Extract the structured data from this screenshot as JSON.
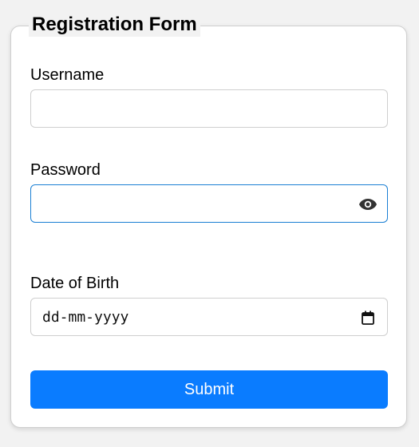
{
  "form": {
    "legend": "Registration Form",
    "fields": [
      {
        "label": "Username",
        "value": ""
      },
      {
        "label": "Password",
        "value": ""
      },
      {
        "label": "Date of Birth",
        "value": "dd-mm-yyyy"
      }
    ],
    "submit_label": "Submit"
  },
  "icons": {
    "password_toggle": "eye-icon",
    "date_picker": "calendar-icon"
  },
  "colors": {
    "accent": "#0a7cff",
    "focus_border": "#1a7fd4"
  }
}
